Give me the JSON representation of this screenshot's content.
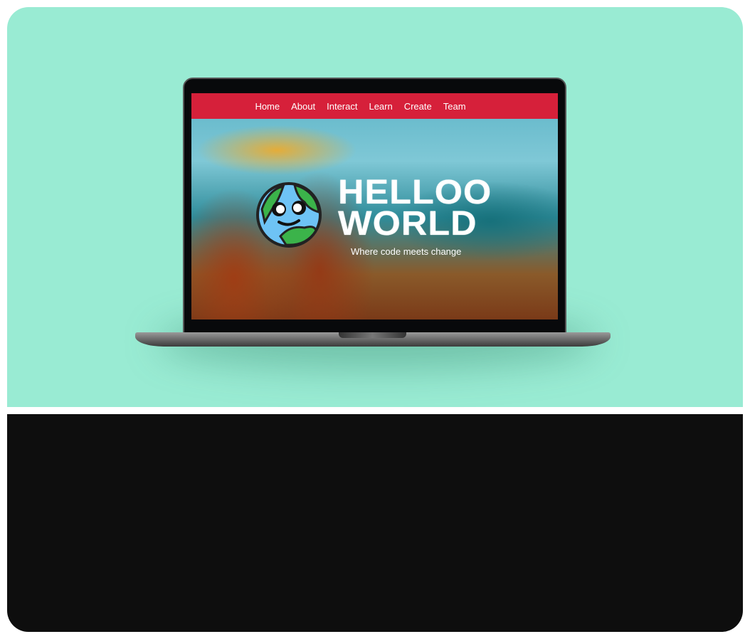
{
  "nav": {
    "items": [
      "Home",
      "About",
      "Interact",
      "Learn",
      "Create",
      "Team"
    ],
    "background": "#d6203a"
  },
  "hero": {
    "title_line1": "HELLOO",
    "title_line2": "WORLD",
    "tagline": "Where code meets change",
    "logo": "smiling-earth-globe"
  },
  "colors": {
    "backdrop": "#99ebd3",
    "lower_panel": "#0e0e0e"
  }
}
